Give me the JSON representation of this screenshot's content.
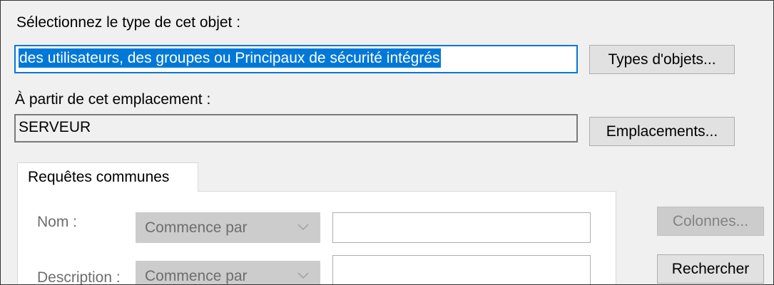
{
  "object_type": {
    "label": "Sélectionnez le type de cet objet :",
    "value": "des utilisateurs, des groupes ou Principaux de sécurité intégrés",
    "button": "Types d'objets..."
  },
  "location": {
    "label": "À partir de cet emplacement :",
    "value": "SERVEUR",
    "button": "Emplacements..."
  },
  "tabs": [
    {
      "label": "Requêtes communes"
    }
  ],
  "query": {
    "name_label": "Nom :",
    "name_operator": "Commence par",
    "description_label": "Description :",
    "description_operator": "Commence par"
  },
  "side_buttons": {
    "columns": "Colonnes...",
    "search": "Rechercher"
  },
  "icons": {
    "combo_arrow": "chevron-down-icon"
  },
  "colors": {
    "accent": "#0078d7",
    "dialog_bg": "#f0f0f0",
    "disabled_text": "#838383"
  }
}
